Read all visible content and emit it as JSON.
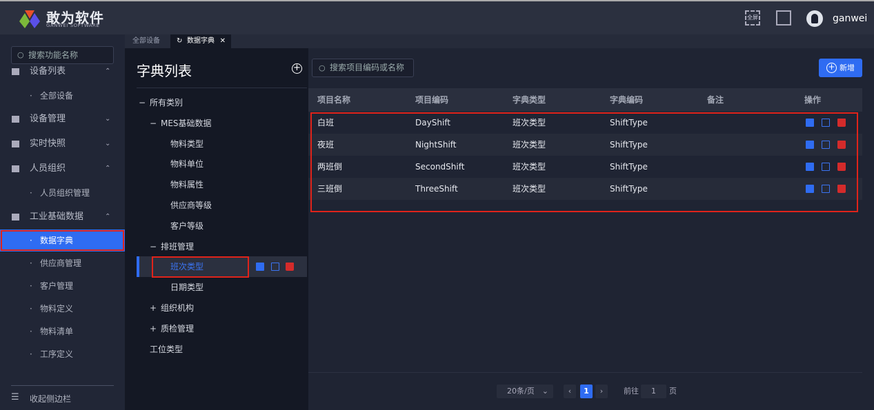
{
  "header": {
    "brand": "敢为软件",
    "brand_sub": "GANWEI SOFTWARE",
    "fullscreen_label": "全屏",
    "username": "ganwei"
  },
  "sidebar": {
    "search_placeholder": "搜索功能名称",
    "items": [
      {
        "label": "设备列表",
        "type": "group",
        "expanded": true
      },
      {
        "label": "全部设备",
        "type": "sub"
      },
      {
        "label": "设备管理",
        "type": "group",
        "expanded": false
      },
      {
        "label": "实时快照",
        "type": "group",
        "expanded": false
      },
      {
        "label": "人员组织",
        "type": "group",
        "expanded": true
      },
      {
        "label": "人员组织管理",
        "type": "sub"
      },
      {
        "label": "工业基础数据",
        "type": "group",
        "expanded": true
      },
      {
        "label": "数据字典",
        "type": "sub",
        "active": true
      },
      {
        "label": "供应商管理",
        "type": "sub"
      },
      {
        "label": "客户管理",
        "type": "sub"
      },
      {
        "label": "物料定义",
        "type": "sub"
      },
      {
        "label": "物料清单",
        "type": "sub"
      },
      {
        "label": "工序定义",
        "type": "sub"
      }
    ],
    "collapse_label": "收起侧边栏"
  },
  "tabs": [
    {
      "label": "全部设备"
    },
    {
      "label": "数据字典",
      "active": true
    }
  ],
  "tree": {
    "title": "字典列表",
    "nodes": [
      {
        "label": "所有类别",
        "prefix": "−",
        "level": 0
      },
      {
        "label": "MES基础数据",
        "prefix": "−",
        "level": 1
      },
      {
        "label": "物料类型",
        "prefix": "",
        "level": 2
      },
      {
        "label": "物料单位",
        "prefix": "",
        "level": 2
      },
      {
        "label": "物料属性",
        "prefix": "",
        "level": 2
      },
      {
        "label": "供应商等级",
        "prefix": "",
        "level": 2
      },
      {
        "label": "客户等级",
        "prefix": "",
        "level": 2
      },
      {
        "label": "排班管理",
        "prefix": "−",
        "level": 1
      },
      {
        "label": "班次类型",
        "prefix": "",
        "level": 2,
        "selected": true
      },
      {
        "label": "日期类型",
        "prefix": "",
        "level": 2
      },
      {
        "label": "组织机构",
        "prefix": "+",
        "level": 1
      },
      {
        "label": "质检管理",
        "prefix": "+",
        "level": 1
      },
      {
        "label": "工位类型",
        "prefix": "",
        "level": 1
      }
    ]
  },
  "main": {
    "search_placeholder": "搜索项目编码或名称",
    "add_label": "新增",
    "columns": [
      "项目名称",
      "项目编码",
      "字典类型",
      "字典编码",
      "备注",
      "操作"
    ],
    "rows": [
      [
        "白班",
        "DayShift",
        "班次类型",
        "ShiftType",
        ""
      ],
      [
        "夜班",
        "NightShift",
        "班次类型",
        "ShiftType",
        ""
      ],
      [
        "两班倒",
        "SecondShift",
        "班次类型",
        "ShiftType",
        ""
      ],
      [
        "三班倒",
        "ThreeShift",
        "班次类型",
        "ShiftType",
        ""
      ]
    ],
    "pagination": {
      "page_size": "20条/页",
      "current_page": "1",
      "goto_label": "前往",
      "goto_value": "1",
      "page_suffix": "页"
    }
  },
  "colors": {
    "accent": "#2f6cf2",
    "danger": "#d42b2b",
    "highlight": "#e0231a"
  }
}
